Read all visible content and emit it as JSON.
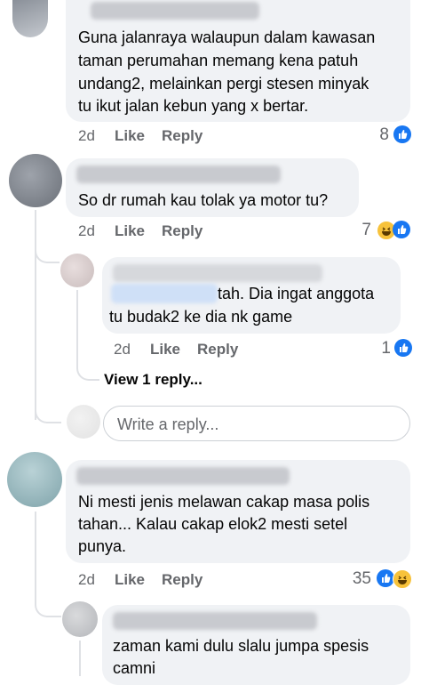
{
  "comments": [
    {
      "text_lines": [
        "Guna jalanraya walaupun dalam kawasan",
        "taman perumahan memang kena patuh",
        "undang2, melainkan pergi stesen minyak",
        "tu ikut jalan kebun yang x bertar."
      ],
      "time": "2d",
      "like_label": "Like",
      "reply_label": "Reply",
      "reaction_count": "8",
      "reactions": [
        "like-icon"
      ]
    },
    {
      "text_lines": [
        "So dr rumah kau tolak ya motor tu?"
      ],
      "time": "2d",
      "like_label": "Like",
      "reply_label": "Reply",
      "reaction_count": "7",
      "reactions": [
        "haha-icon",
        "like-icon"
      ]
    },
    {
      "text_lines": [
        "tah. Dia ingat anggota",
        "tu budak2 ke dia nk game"
      ],
      "time": "2d",
      "like_label": "Like",
      "reply_label": "Reply",
      "reaction_count": "1",
      "reactions": [
        "like-icon"
      ]
    },
    {
      "text_lines": [
        "Ni mesti jenis melawan cakap masa polis",
        "tahan... Kalau cakap elok2 mesti setel",
        "punya."
      ],
      "time": "2d",
      "like_label": "Like",
      "reply_label": "Reply",
      "reaction_count": "35",
      "reactions": [
        "like-icon",
        "haha-icon"
      ]
    },
    {
      "text_lines": [
        "zaman kami dulu slalu jumpa spesis",
        "camni"
      ]
    }
  ],
  "view_replies": "View 1 reply...",
  "reply_box": {
    "placeholder": "Write a reply..."
  },
  "colors": {
    "bubble": "#f0f2f5",
    "like_blue": "#1877f2",
    "meta_gray": "#65676b"
  }
}
